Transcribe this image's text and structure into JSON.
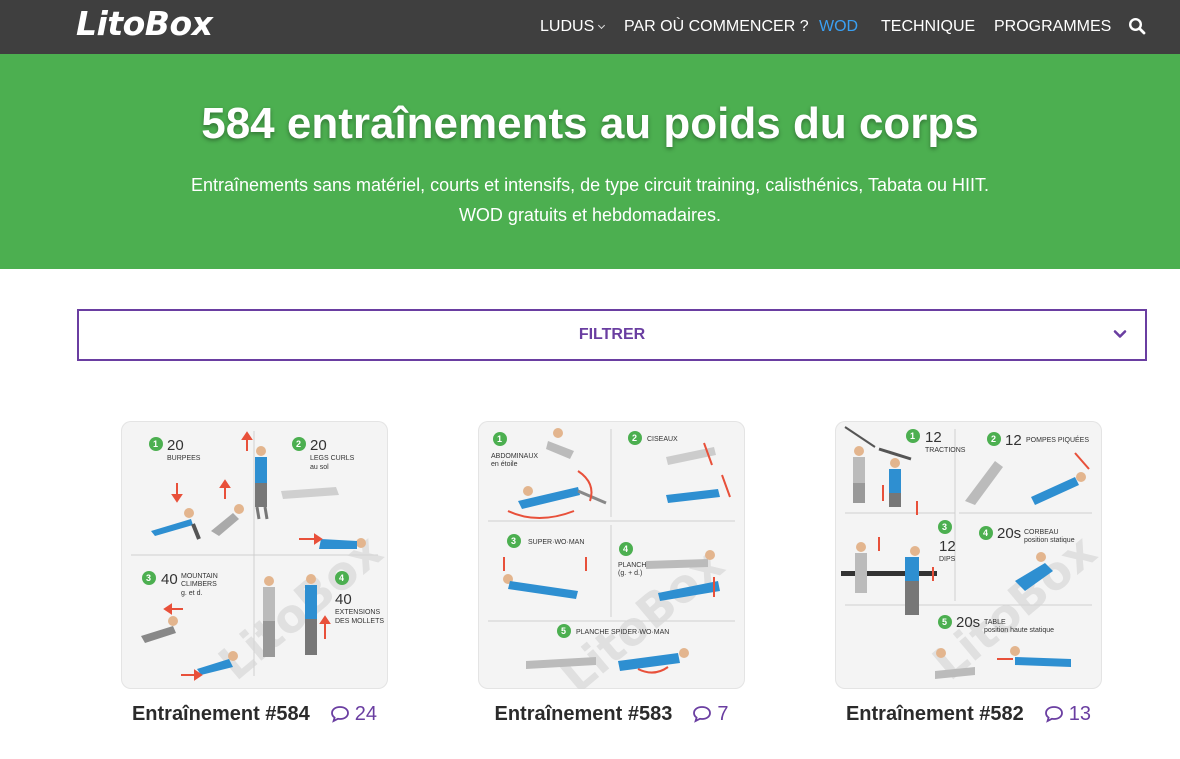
{
  "header": {
    "logo": "LitoBox",
    "nav": [
      {
        "label": "LUDUS",
        "has_dropdown": true,
        "active": false
      },
      {
        "label": "PAR OÙ COMMENCER ?",
        "has_dropdown": false,
        "active": false
      },
      {
        "label": "WOD",
        "has_dropdown": false,
        "active": true
      },
      {
        "label": "TECHNIQUE",
        "has_dropdown": false,
        "active": false
      },
      {
        "label": "PROGRAMMES",
        "has_dropdown": false,
        "active": false
      }
    ],
    "search_icon": "search-icon"
  },
  "hero": {
    "title": "584 entraînements au poids du corps",
    "subtitle_line1": "Entraînements sans matériel, courts et intensifs, de type circuit training, calisthénics, Tabata ou HIIT.",
    "subtitle_line2": "WOD gratuits et hebdomadaires."
  },
  "filter": {
    "label": "FILTRER",
    "icon": "chevron-down-icon"
  },
  "colors": {
    "topbar": "#3f3f3f",
    "hero": "#4caf50",
    "accent_purple": "#6a3ea1",
    "active_nav": "#3aa0f3",
    "badge_green": "#4caf50",
    "figure_blue": "#2e8fd1",
    "arrow_red": "#e8503a"
  },
  "cards": [
    {
      "title": "Entraînement #584",
      "comments": "24",
      "watermark": "LitoBox",
      "exercises": [
        {
          "n": "1",
          "count": "20",
          "name": "BURPEES"
        },
        {
          "n": "2",
          "count": "20",
          "name": "LEGS CURLS",
          "note": "au sol"
        },
        {
          "n": "3",
          "count": "40",
          "name": "MOUNTAIN",
          "name2": "CLIMBERS",
          "note": "g. et d."
        },
        {
          "n": "4",
          "count": "40",
          "name": "EXTENSIONS",
          "name2": "DES MOLLETS"
        }
      ]
    },
    {
      "title": "Entraînement #583",
      "comments": "7",
      "watermark": "LitoBox",
      "exercises": [
        {
          "n": "1",
          "name": "ABDOMINAUX",
          "note": "en étoile"
        },
        {
          "n": "2",
          "name": "CISEAUX"
        },
        {
          "n": "3",
          "name": "SUPER·WO·MAN"
        },
        {
          "n": "4",
          "name": "PLANCHE TWIST",
          "note": "(g. + d.)"
        },
        {
          "n": "5",
          "name": "PLANCHE SPIDER·WO·MAN"
        }
      ]
    },
    {
      "title": "Entraînement #582",
      "comments": "13",
      "watermark": "LitoBox",
      "exercises": [
        {
          "n": "1",
          "count": "12",
          "name": "TRACTIONS"
        },
        {
          "n": "2",
          "count": "12",
          "name": "POMPES PIQUÉES"
        },
        {
          "n": "3",
          "count": "12",
          "name": "DIPS"
        },
        {
          "n": "4",
          "count": "20s",
          "name": "CORBEAU",
          "note": "position statique"
        },
        {
          "n": "5",
          "count": "20s",
          "name": "TABLE",
          "note": "position haute statique"
        }
      ]
    }
  ]
}
